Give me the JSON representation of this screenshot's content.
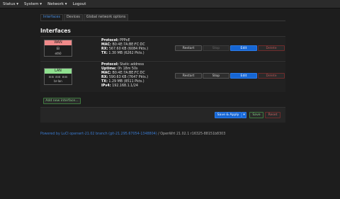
{
  "topbar": {
    "menus": [
      {
        "label": "Status ▾"
      },
      {
        "label": "System ▾"
      },
      {
        "label": "Network ▾"
      },
      {
        "label": "Logout"
      }
    ]
  },
  "tabs": [
    {
      "label": "Interfaces",
      "active": true
    },
    {
      "label": "Devices",
      "active": false
    },
    {
      "label": "Global network options",
      "active": false
    }
  ],
  "section_title": "Interfaces",
  "interfaces": [
    {
      "name": "WAN",
      "device": "eth0",
      "header_color": "#f08a8a",
      "glyph": "⊟",
      "protocol_label": "Protocol:",
      "protocol": "PPPoE",
      "mac_label": "MAC:",
      "mac": "B0:4E:7A:BE:FC:DC",
      "rx_label": "RX:",
      "rx": "567.60 KB (6084 Pkts.)",
      "tx_label": "TX:",
      "tx": "1.30 MB (6262 Pkts.)"
    },
    {
      "name": "LAN",
      "device": "br-lan",
      "header_color": "#8fe08f",
      "glyph": "⊟⊟ ⊟⊟ ⊟⊟",
      "protocol_label": "Protocol:",
      "protocol": "Static address",
      "uptime_label": "Uptime:",
      "uptime": "0h 18m 50s",
      "mac_label": "MAC:",
      "mac": "B0:4E:7A:BE:FC:DC",
      "rx_label": "RX:",
      "rx": "590.63 KB (7647 Pkts.)",
      "tx_label": "TX:",
      "tx": "1.29 MB (8511 Pkts.)",
      "ipv4_label": "IPv4:",
      "ipv4": "192.168.1.1/24"
    }
  ],
  "row_buttons": {
    "restart": "Restart",
    "stop": "Stop",
    "edit": "Edit",
    "delete": "Delete"
  },
  "add_interface": "Add new interface...",
  "actions": {
    "save_apply": "Save & Apply",
    "dropdown": "▾",
    "save": "Save",
    "reset": "Reset"
  },
  "footer": {
    "link": "Powered by LuCI openwrt-21.02 branch (git-21.295.67054-1348804)",
    "suffix": " / OpenWrt 21.02.1 r16325-88151b8303"
  }
}
